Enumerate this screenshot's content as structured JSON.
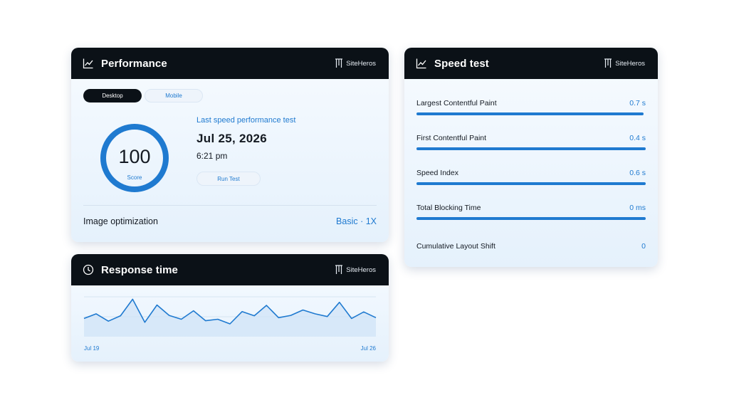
{
  "brand": "SiteHeros",
  "colors": {
    "accent": "#1f7ad0",
    "header": "#0b1117"
  },
  "performance": {
    "title": "Performance",
    "icon": "line-chart-icon",
    "tabs": [
      {
        "label": "Desktop",
        "active": true
      },
      {
        "label": "Mobile",
        "active": false
      }
    ],
    "score": "100",
    "score_label": "Score",
    "score_fraction": 1.0,
    "last_test_label": "Last speed performance test",
    "date": "Jul 25, 2026",
    "time": "6:21 pm",
    "run_button": "Run Test",
    "image_opt_label": "Image optimization",
    "image_opt_value": "Basic · 1X"
  },
  "response_time": {
    "title": "Response time",
    "icon": "clock-icon",
    "x_start_label": "Jul 19",
    "x_end_label": "Jul 26",
    "series": [
      0.4,
      0.52,
      0.33,
      0.47,
      0.9,
      0.3,
      0.75,
      0.48,
      0.38,
      0.6,
      0.34,
      0.38,
      0.26,
      0.58,
      0.47,
      0.74,
      0.42,
      0.48,
      0.62,
      0.52,
      0.45,
      0.82,
      0.4,
      0.57,
      0.42
    ]
  },
  "speed_test": {
    "title": "Speed test",
    "icon": "line-chart-icon",
    "metrics": [
      {
        "label": "Largest Contentful Paint",
        "value": "0.7 s",
        "bar_fraction": 0.99
      },
      {
        "label": "First Contentful Paint",
        "value": "0.4 s",
        "bar_fraction": 1.0
      },
      {
        "label": "Speed Index",
        "value": "0.6 s",
        "bar_fraction": 1.0
      },
      {
        "label": "Total Blocking Time",
        "value": "0 ms",
        "bar_fraction": 1.0
      },
      {
        "label": "Cumulative Layout Shift",
        "value": "0",
        "bar_fraction": 0
      }
    ]
  }
}
